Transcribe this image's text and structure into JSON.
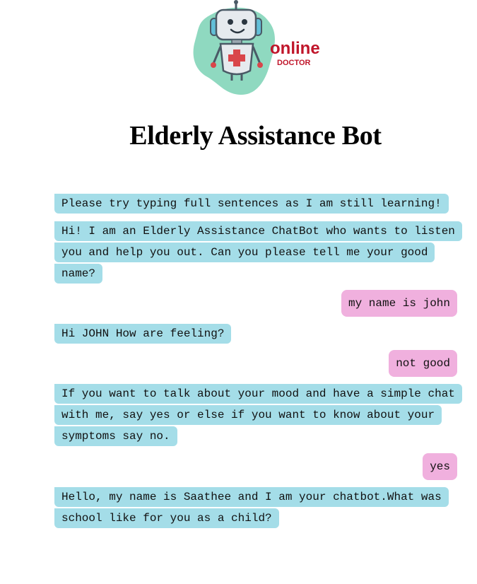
{
  "logo": {
    "brand_top": "online",
    "brand_bottom": "DOCTOR"
  },
  "page": {
    "title": "Elderly Assistance Bot"
  },
  "messages": [
    {
      "sender": "bot",
      "text": "Please try typing full sentences as I am still learning!"
    },
    {
      "sender": "bot",
      "text": "Hi! I am an Elderly Assistance ChatBot who wants to listen you and help you out. Can you please tell me your good name?"
    },
    {
      "sender": "user",
      "text": "my name is john"
    },
    {
      "sender": "bot",
      "text": "Hi JOHN How are feeling?"
    },
    {
      "sender": "user",
      "text": "not good"
    },
    {
      "sender": "bot",
      "text": "If you want to talk about your mood and have a simple chat with me, say yes or else if you want to know about your symptoms say no."
    },
    {
      "sender": "user",
      "text": "yes"
    },
    {
      "sender": "bot",
      "text": "Hello, my name is Saathee and I am your chatbot.What was school like for you as a child?"
    }
  ],
  "colors": {
    "bot_bubble": "#a4dde8",
    "user_bubble": "#f0b0de",
    "logo_blob": "#8fd9c0",
    "logo_text": "#c0152a"
  }
}
